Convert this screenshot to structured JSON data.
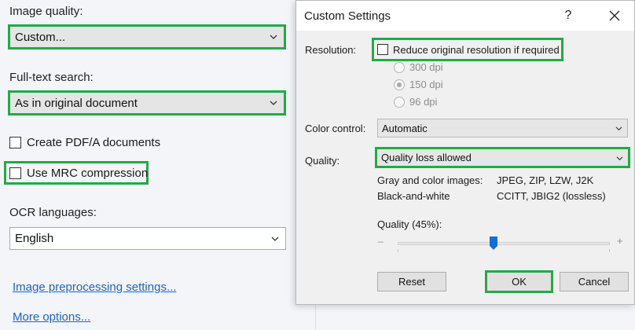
{
  "left": {
    "image_quality_label": "Image quality:",
    "image_quality_value": "Custom...",
    "fulltext_label": "Full-text search:",
    "fulltext_value": "As in original document",
    "pdfa_label": "Create PDF/A documents",
    "mrc_label": "Use MRC compression",
    "ocr_label": "OCR languages:",
    "ocr_value": "English",
    "preprocessing_link": "Image preprocessing settings...",
    "more_options_link": "More options..."
  },
  "dialog": {
    "title": "Custom Settings",
    "help": "?",
    "resolution_label": "Resolution:",
    "reduce_label": "Reduce original resolution if required",
    "dpi_options": [
      "300 dpi",
      "150 dpi",
      "96 dpi"
    ],
    "dpi_selected": "150 dpi",
    "color_control_label": "Color control:",
    "color_control_value": "Automatic",
    "quality_label": "Quality:",
    "quality_value": "Quality loss allowed",
    "gray_color_label": "Gray and color images:",
    "gray_color_value": "JPEG, ZIP, LZW, J2K",
    "bw_label": "Black-and-white",
    "bw_value": "CCITT, JBIG2 (lossless)",
    "slider_label": "Quality (45%):",
    "slider_value_percent": 45,
    "slider_minus": "–",
    "slider_plus": "+",
    "reset_label": "Reset",
    "ok_label": "OK",
    "cancel_label": "Cancel"
  },
  "colors": {
    "highlight": "#24a945",
    "link": "#1b64c4",
    "slider_thumb": "#0f6fd6"
  },
  "icons": [
    "chevron-down-icon",
    "close-icon",
    "slider-thumb"
  ]
}
